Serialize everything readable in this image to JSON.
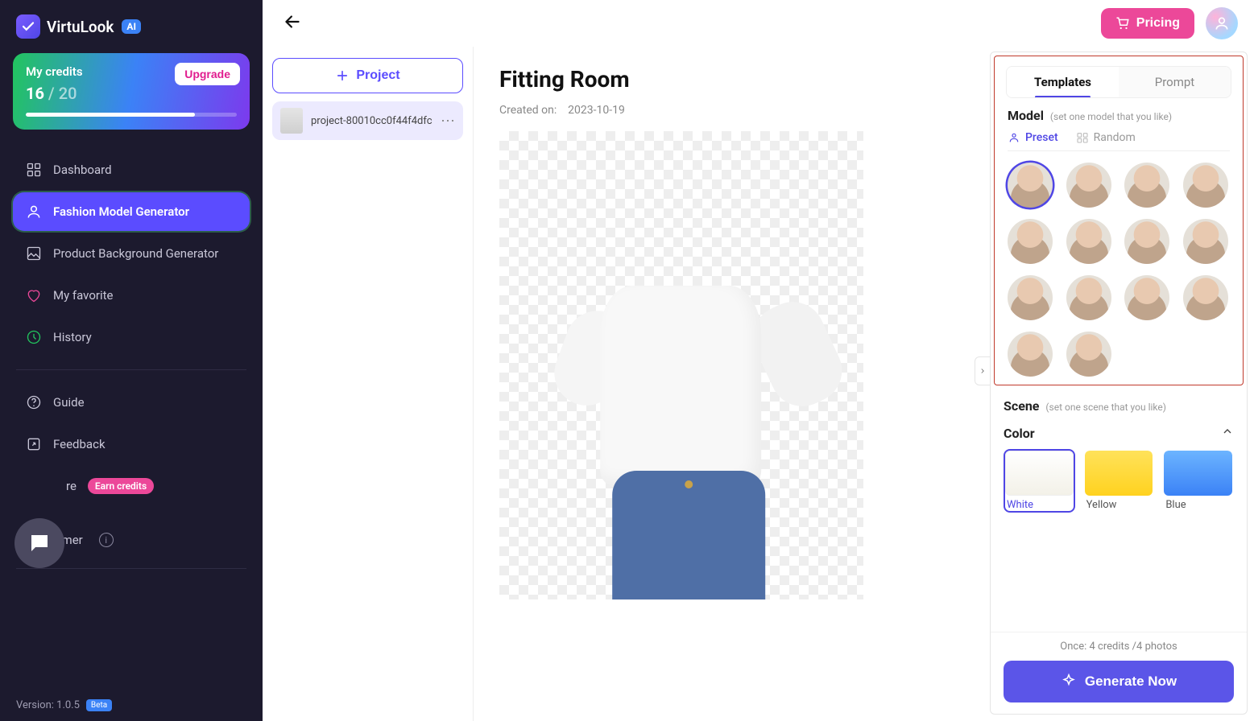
{
  "brand": {
    "name": "VirtuLook",
    "ai_badge": "AI"
  },
  "credits": {
    "title": "My credits",
    "current": "16",
    "sep": " / ",
    "max": "20",
    "upgrade_label": "Upgrade"
  },
  "nav": {
    "dashboard": "Dashboard",
    "fashion": "Fashion Model Generator",
    "product_bg": "Product Background Generator",
    "favorite": "My favorite",
    "history": "History",
    "guide": "Guide",
    "feedback": "Feedback",
    "share": "re",
    "earn_badge": "Earn credits",
    "disclaimer": "Disclaimer"
  },
  "version": {
    "label": "Version: 1.0.5",
    "beta": "Beta"
  },
  "topbar": {
    "pricing": "Pricing"
  },
  "projects": {
    "new_label": "Project",
    "items": [
      {
        "name": "project-80010cc0f44f4dfc"
      }
    ]
  },
  "canvas": {
    "title": "Fitting Room",
    "created_label": "Created on:",
    "created_value": "2023-10-19"
  },
  "panel": {
    "tabs": {
      "templates": "Templates",
      "prompt": "Prompt"
    },
    "model_title": "Model",
    "model_hint": "(set one model that you like)",
    "subtabs": {
      "preset": "Preset",
      "random": "Random"
    },
    "scene_title": "Scene",
    "scene_hint": "(set one scene that you like)",
    "color_title": "Color",
    "swatches": {
      "white": "White",
      "yellow": "Yellow",
      "blue": "Blue"
    },
    "once_text": "Once: 4 credits /4 photos",
    "generate": "Generate Now"
  }
}
